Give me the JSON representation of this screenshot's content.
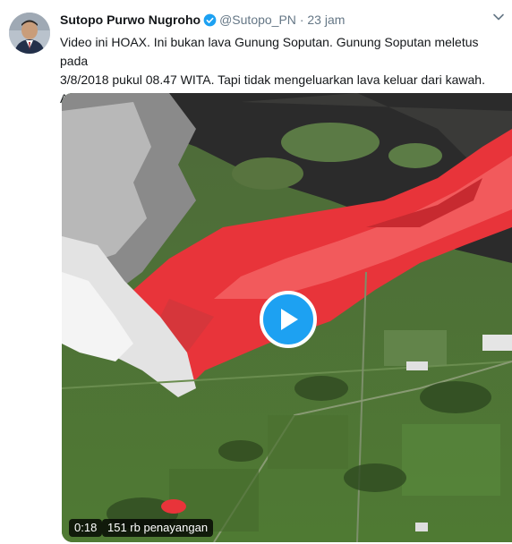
{
  "tweet": {
    "author_name": "Sutopo Purwo Nugroho",
    "handle": "@Sutopo_PN",
    "separator": "·",
    "time": "23 jam",
    "verified": true,
    "text": "Video ini HOAX. Ini bukan lava Gunung Soputan. Gunung Soputan meletus pada\n3/8/2018 pukul 08.47 WITA. Tapi tidak mengeluarkan lava keluar dari kawah.\nAbaikan dan delete jika menerima video ini di medsos.",
    "icons": {
      "verified": "verified-badge-icon",
      "caret": "chevron-down-icon",
      "play": "play-icon"
    }
  },
  "video": {
    "duration": "0:18",
    "views": "151 rb penayangan"
  },
  "colors": {
    "accent": "#1da1f2",
    "name_text": "#14171a",
    "muted_text": "#657786",
    "lava": "#e8343a"
  }
}
